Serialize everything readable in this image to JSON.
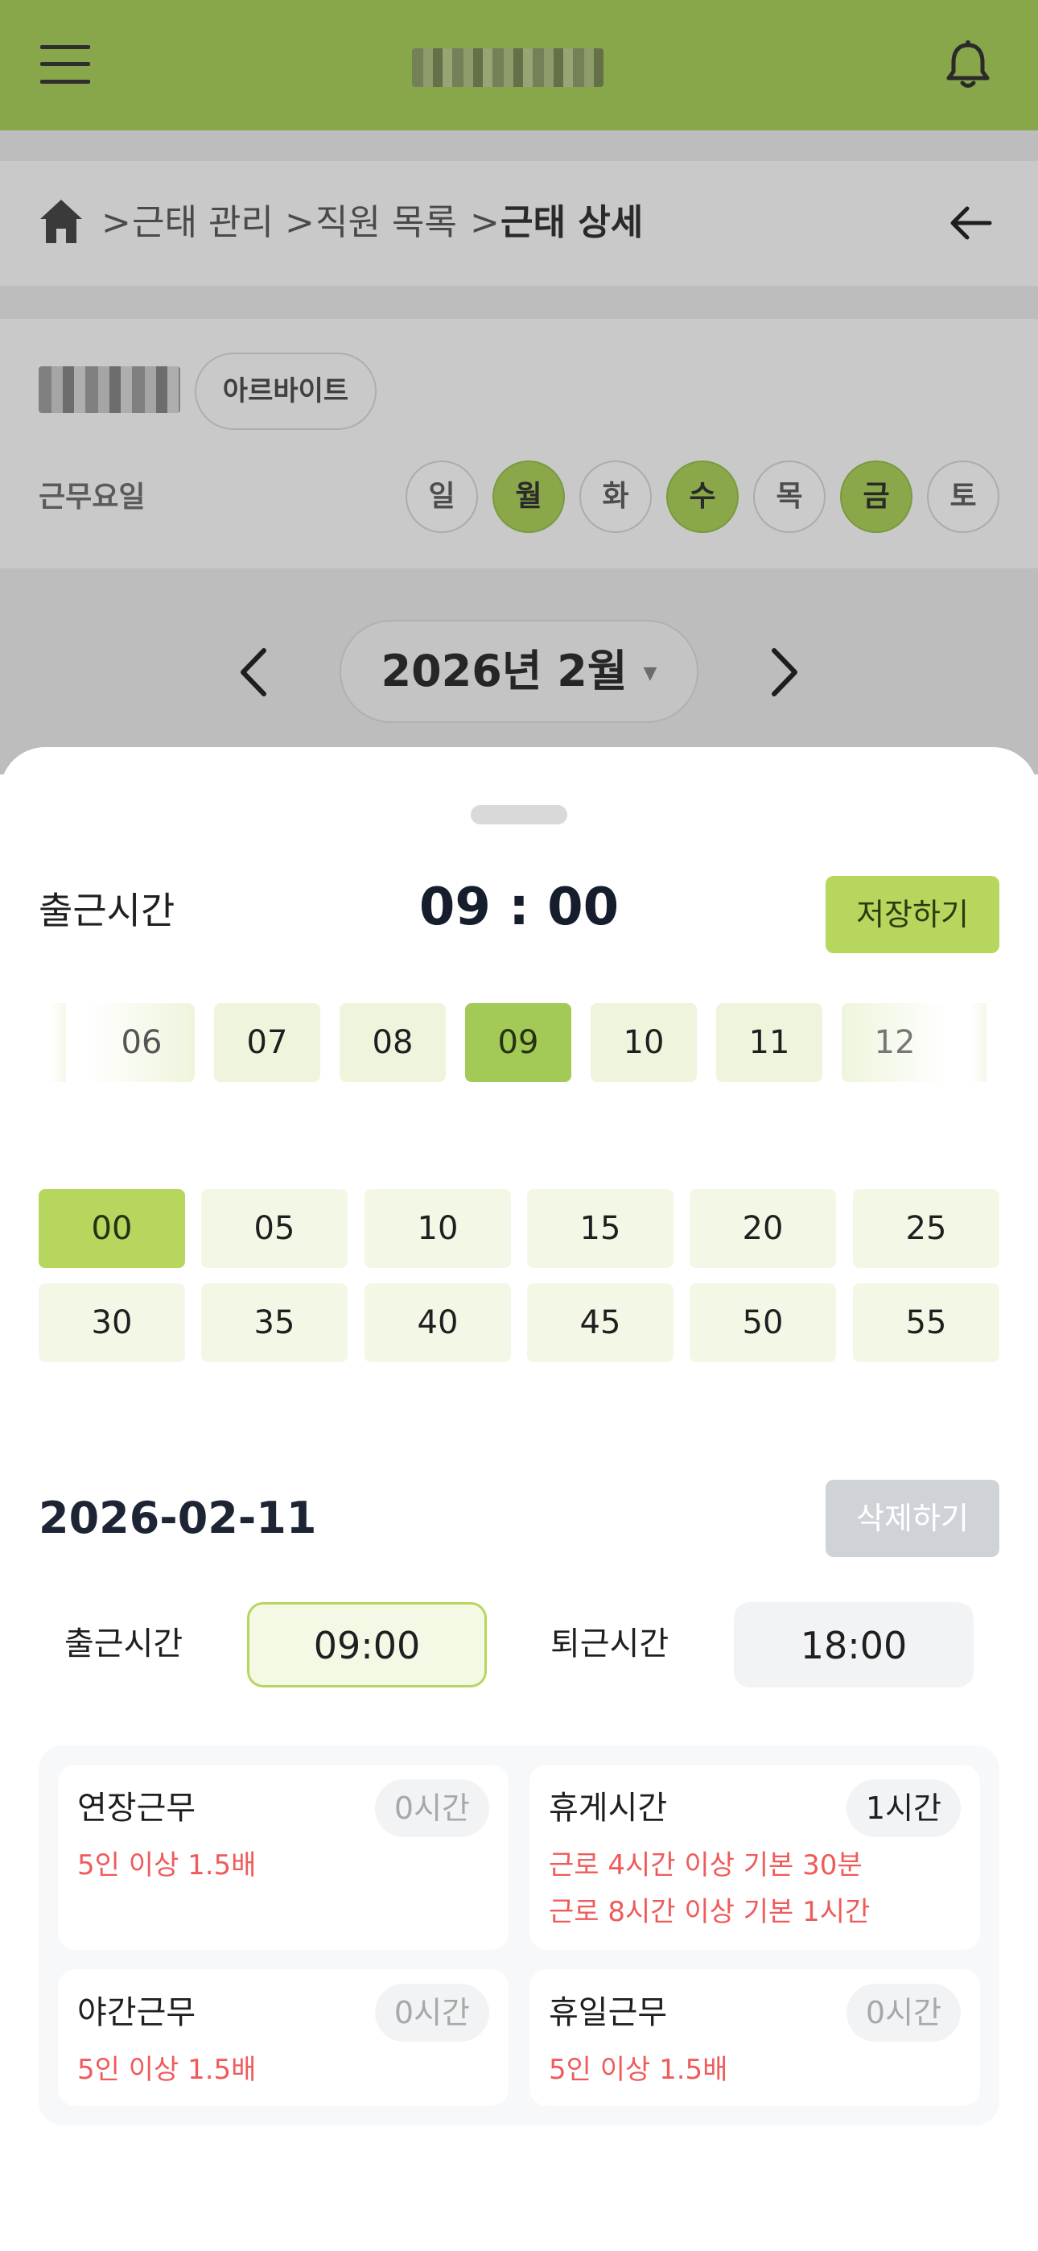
{
  "header": {
    "title": "",
    "menu_icon": "hamburger-icon",
    "bell_icon": "bell-icon"
  },
  "breadcrumb": {
    "items": [
      "근태 관리",
      "직원 목록",
      "근태 상세"
    ],
    "separator": ">"
  },
  "employee": {
    "type": "아르바이트",
    "workdays_label": "근무요일",
    "days": [
      {
        "label": "일",
        "active": false
      },
      {
        "label": "월",
        "active": true
      },
      {
        "label": "화",
        "active": false
      },
      {
        "label": "수",
        "active": true
      },
      {
        "label": "목",
        "active": false
      },
      {
        "label": "금",
        "active": true
      },
      {
        "label": "토",
        "active": false
      }
    ]
  },
  "month": {
    "label": "2026년 2월",
    "caret": "▼"
  },
  "picker": {
    "label": "출근시간",
    "value": "09 : 00",
    "save_label": "저장하기",
    "hours": [
      "06",
      "07",
      "08",
      "09",
      "10",
      "11",
      "12"
    ],
    "selected_hour": "09",
    "minutes": [
      "00",
      "05",
      "10",
      "15",
      "20",
      "25",
      "30",
      "35",
      "40",
      "45",
      "50",
      "55"
    ],
    "selected_minute": "00"
  },
  "record": {
    "date": "2026-02-11",
    "delete_label": "삭제하기",
    "start_label": "출근시간",
    "start_value": "09:00",
    "end_label": "퇴근시간",
    "end_value": "18:00"
  },
  "summary": {
    "overtime": {
      "title": "연장근무",
      "hours": "0시간",
      "notes": [
        "5인 이상 1.5배"
      ]
    },
    "break": {
      "title": "휴게시간",
      "hours": "1시간",
      "notes": [
        "근로 4시간 이상 기본 30분",
        "근로 8시간 이상 기본 1시간"
      ]
    },
    "night": {
      "title": "야간근무",
      "hours": "0시간",
      "notes": [
        "5인 이상 1.5배"
      ]
    },
    "holiday": {
      "title": "휴일근무",
      "hours": "0시간",
      "notes": [
        "5인 이상 1.5배"
      ]
    }
  },
  "colors": {
    "brand_green": "#88a64a",
    "accent_green": "#b6d65e",
    "warning_red": "#ef5b5b"
  }
}
